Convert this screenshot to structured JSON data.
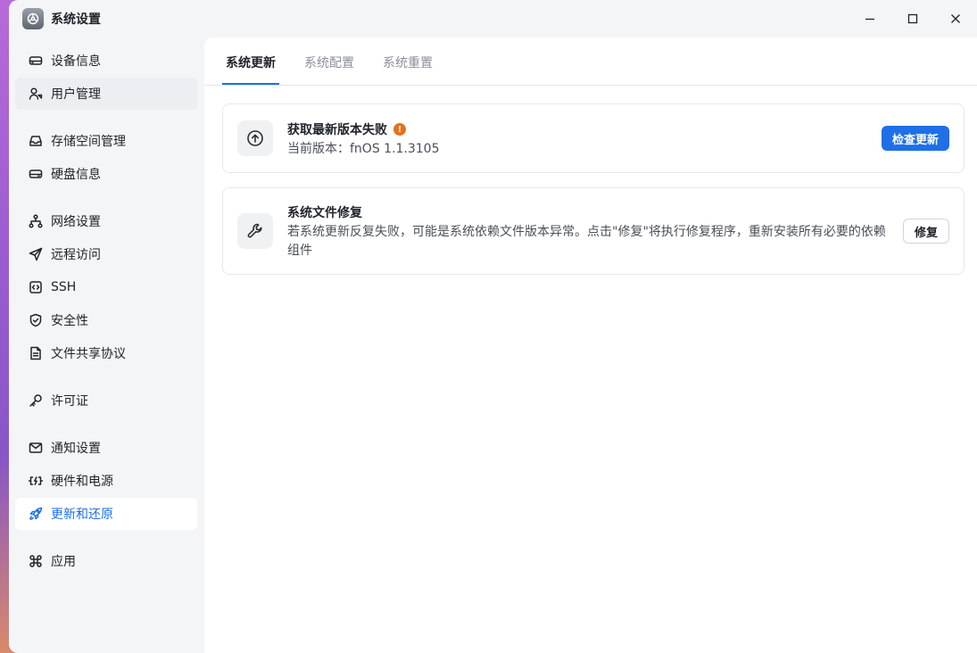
{
  "window": {
    "title": "系统设置",
    "icon": "settings-app-icon",
    "controls": [
      "minimize-icon",
      "maximize-icon",
      "close-icon"
    ]
  },
  "sidebar": {
    "items": [
      {
        "label": "设备信息",
        "icon": "device-icon"
      },
      {
        "label": "用户管理",
        "icon": "user-icon"
      },
      {
        "label": "存储空间管理",
        "icon": "storage-icon"
      },
      {
        "label": "硬盘信息",
        "icon": "disk-icon"
      },
      {
        "label": "网络设置",
        "icon": "network-icon"
      },
      {
        "label": "远程访问",
        "icon": "send-icon"
      },
      {
        "label": "SSH",
        "icon": "terminal-icon"
      },
      {
        "label": "安全性",
        "icon": "shield-icon"
      },
      {
        "label": "文件共享协议",
        "icon": "file-icon"
      },
      {
        "label": "许可证",
        "icon": "key-icon"
      },
      {
        "label": "通知设置",
        "icon": "mail-icon"
      },
      {
        "label": "硬件和电源",
        "icon": "power-icon"
      },
      {
        "label": "更新和还原",
        "icon": "rocket-icon"
      },
      {
        "label": "应用",
        "icon": "apps-icon"
      }
    ],
    "active_index": 12,
    "hover_index": 1
  },
  "tabs": [
    {
      "label": "系统更新"
    },
    {
      "label": "系统配置"
    },
    {
      "label": "系统重置"
    }
  ],
  "update_card": {
    "title": "获取最新版本失败",
    "badge": "!",
    "version_text": "当前版本：fnOS 1.1.3105",
    "button_label": "检查更新",
    "icon": "arrow-up-circle-icon"
  },
  "repair_card": {
    "title": "系统文件修复",
    "description": "若系统更新反复失败，可能是系统依赖文件版本异常。点击\"修复\"将执行修复程序，重新安装所有必要的依赖组件",
    "button_label": "修复",
    "icon": "wrench-icon"
  },
  "colors": {
    "accent": "#1e6fe8",
    "warning": "#e8701a",
    "sidebar_bg": "#f4f5f7",
    "content_bg": "#ffffff"
  }
}
